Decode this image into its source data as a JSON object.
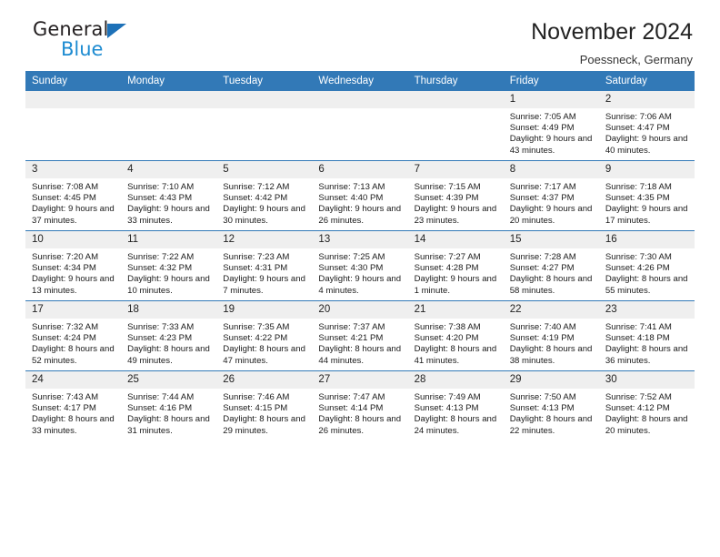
{
  "brand": {
    "name_part1": "General",
    "name_part2": "Blue",
    "triangle_color": "#1d71b8",
    "blue_color": "#1d8bd1"
  },
  "header": {
    "title": "November 2024",
    "subtitle": "Poessneck, Germany"
  },
  "theme": {
    "header_row_bg": "#3279b7",
    "daynum_bg": "#efefef",
    "row_divider": "#3279b7"
  },
  "weekdays": [
    "Sunday",
    "Monday",
    "Tuesday",
    "Wednesday",
    "Thursday",
    "Friday",
    "Saturday"
  ],
  "labels": {
    "sunrise_prefix": "Sunrise: ",
    "sunset_prefix": "Sunset: ",
    "daylight_prefix": "Daylight: "
  },
  "weeks": [
    [
      {
        "day": "",
        "empty": true
      },
      {
        "day": "",
        "empty": true
      },
      {
        "day": "",
        "empty": true
      },
      {
        "day": "",
        "empty": true
      },
      {
        "day": "",
        "empty": true
      },
      {
        "day": "1",
        "sunrise": "Sunrise: 7:05 AM",
        "sunset": "Sunset: 4:49 PM",
        "daylight": "Daylight: 9 hours and 43 minutes."
      },
      {
        "day": "2",
        "sunrise": "Sunrise: 7:06 AM",
        "sunset": "Sunset: 4:47 PM",
        "daylight": "Daylight: 9 hours and 40 minutes."
      }
    ],
    [
      {
        "day": "3",
        "sunrise": "Sunrise: 7:08 AM",
        "sunset": "Sunset: 4:45 PM",
        "daylight": "Daylight: 9 hours and 37 minutes."
      },
      {
        "day": "4",
        "sunrise": "Sunrise: 7:10 AM",
        "sunset": "Sunset: 4:43 PM",
        "daylight": "Daylight: 9 hours and 33 minutes."
      },
      {
        "day": "5",
        "sunrise": "Sunrise: 7:12 AM",
        "sunset": "Sunset: 4:42 PM",
        "daylight": "Daylight: 9 hours and 30 minutes."
      },
      {
        "day": "6",
        "sunrise": "Sunrise: 7:13 AM",
        "sunset": "Sunset: 4:40 PM",
        "daylight": "Daylight: 9 hours and 26 minutes."
      },
      {
        "day": "7",
        "sunrise": "Sunrise: 7:15 AM",
        "sunset": "Sunset: 4:39 PM",
        "daylight": "Daylight: 9 hours and 23 minutes."
      },
      {
        "day": "8",
        "sunrise": "Sunrise: 7:17 AM",
        "sunset": "Sunset: 4:37 PM",
        "daylight": "Daylight: 9 hours and 20 minutes."
      },
      {
        "day": "9",
        "sunrise": "Sunrise: 7:18 AM",
        "sunset": "Sunset: 4:35 PM",
        "daylight": "Daylight: 9 hours and 17 minutes."
      }
    ],
    [
      {
        "day": "10",
        "sunrise": "Sunrise: 7:20 AM",
        "sunset": "Sunset: 4:34 PM",
        "daylight": "Daylight: 9 hours and 13 minutes."
      },
      {
        "day": "11",
        "sunrise": "Sunrise: 7:22 AM",
        "sunset": "Sunset: 4:32 PM",
        "daylight": "Daylight: 9 hours and 10 minutes."
      },
      {
        "day": "12",
        "sunrise": "Sunrise: 7:23 AM",
        "sunset": "Sunset: 4:31 PM",
        "daylight": "Daylight: 9 hours and 7 minutes."
      },
      {
        "day": "13",
        "sunrise": "Sunrise: 7:25 AM",
        "sunset": "Sunset: 4:30 PM",
        "daylight": "Daylight: 9 hours and 4 minutes."
      },
      {
        "day": "14",
        "sunrise": "Sunrise: 7:27 AM",
        "sunset": "Sunset: 4:28 PM",
        "daylight": "Daylight: 9 hours and 1 minute."
      },
      {
        "day": "15",
        "sunrise": "Sunrise: 7:28 AM",
        "sunset": "Sunset: 4:27 PM",
        "daylight": "Daylight: 8 hours and 58 minutes."
      },
      {
        "day": "16",
        "sunrise": "Sunrise: 7:30 AM",
        "sunset": "Sunset: 4:26 PM",
        "daylight": "Daylight: 8 hours and 55 minutes."
      }
    ],
    [
      {
        "day": "17",
        "sunrise": "Sunrise: 7:32 AM",
        "sunset": "Sunset: 4:24 PM",
        "daylight": "Daylight: 8 hours and 52 minutes."
      },
      {
        "day": "18",
        "sunrise": "Sunrise: 7:33 AM",
        "sunset": "Sunset: 4:23 PM",
        "daylight": "Daylight: 8 hours and 49 minutes."
      },
      {
        "day": "19",
        "sunrise": "Sunrise: 7:35 AM",
        "sunset": "Sunset: 4:22 PM",
        "daylight": "Daylight: 8 hours and 47 minutes."
      },
      {
        "day": "20",
        "sunrise": "Sunrise: 7:37 AM",
        "sunset": "Sunset: 4:21 PM",
        "daylight": "Daylight: 8 hours and 44 minutes."
      },
      {
        "day": "21",
        "sunrise": "Sunrise: 7:38 AM",
        "sunset": "Sunset: 4:20 PM",
        "daylight": "Daylight: 8 hours and 41 minutes."
      },
      {
        "day": "22",
        "sunrise": "Sunrise: 7:40 AM",
        "sunset": "Sunset: 4:19 PM",
        "daylight": "Daylight: 8 hours and 38 minutes."
      },
      {
        "day": "23",
        "sunrise": "Sunrise: 7:41 AM",
        "sunset": "Sunset: 4:18 PM",
        "daylight": "Daylight: 8 hours and 36 minutes."
      }
    ],
    [
      {
        "day": "24",
        "sunrise": "Sunrise: 7:43 AM",
        "sunset": "Sunset: 4:17 PM",
        "daylight": "Daylight: 8 hours and 33 minutes."
      },
      {
        "day": "25",
        "sunrise": "Sunrise: 7:44 AM",
        "sunset": "Sunset: 4:16 PM",
        "daylight": "Daylight: 8 hours and 31 minutes."
      },
      {
        "day": "26",
        "sunrise": "Sunrise: 7:46 AM",
        "sunset": "Sunset: 4:15 PM",
        "daylight": "Daylight: 8 hours and 29 minutes."
      },
      {
        "day": "27",
        "sunrise": "Sunrise: 7:47 AM",
        "sunset": "Sunset: 4:14 PM",
        "daylight": "Daylight: 8 hours and 26 minutes."
      },
      {
        "day": "28",
        "sunrise": "Sunrise: 7:49 AM",
        "sunset": "Sunset: 4:13 PM",
        "daylight": "Daylight: 8 hours and 24 minutes."
      },
      {
        "day": "29",
        "sunrise": "Sunrise: 7:50 AM",
        "sunset": "Sunset: 4:13 PM",
        "daylight": "Daylight: 8 hours and 22 minutes."
      },
      {
        "day": "30",
        "sunrise": "Sunrise: 7:52 AM",
        "sunset": "Sunset: 4:12 PM",
        "daylight": "Daylight: 8 hours and 20 minutes."
      }
    ]
  ]
}
